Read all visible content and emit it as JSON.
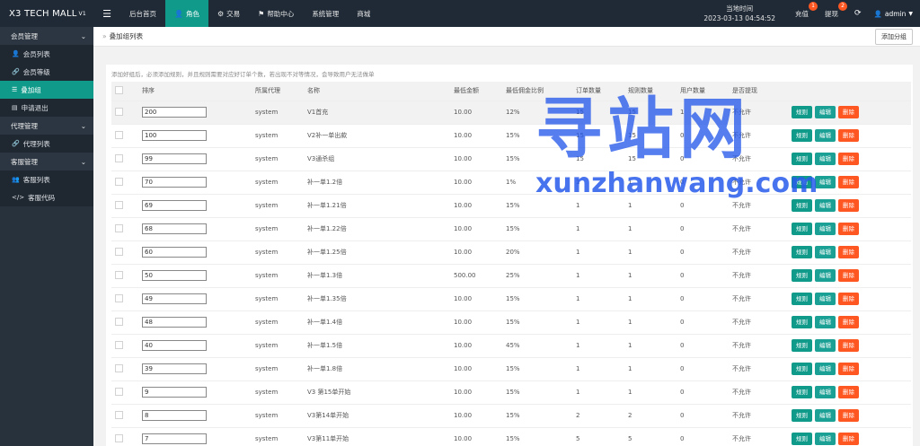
{
  "app": {
    "title": "X3 TECH MALL",
    "version": "V1"
  },
  "topnav": [
    {
      "label": "后台首页",
      "icon": "",
      "active": false
    },
    {
      "label": "角色",
      "icon": "user-icon",
      "active": true
    },
    {
      "label": "交易",
      "icon": "transaction-icon",
      "active": false
    },
    {
      "label": "帮助中心",
      "icon": "flag-icon",
      "active": false
    },
    {
      "label": "系统管理",
      "icon": "",
      "active": false
    },
    {
      "label": "商城",
      "icon": "",
      "active": false
    }
  ],
  "clock": {
    "label": "当地时间",
    "value": "2023-03-13 04:54:52"
  },
  "recharge": {
    "label": "充值",
    "badge": "1"
  },
  "withdraw": {
    "label": "提现",
    "badge": "2"
  },
  "user": {
    "name": "admin"
  },
  "sidebar": {
    "groups": [
      {
        "label": "会员管理",
        "items": [
          {
            "label": "会员列表",
            "icon": "user-icon",
            "active": false
          },
          {
            "label": "会员等级",
            "icon": "link-icon",
            "active": false
          },
          {
            "label": "叠加组",
            "icon": "list-icon",
            "active": true
          },
          {
            "label": "申请退出",
            "icon": "form-icon",
            "active": false
          }
        ]
      },
      {
        "label": "代理管理",
        "items": [
          {
            "label": "代理列表",
            "icon": "link-icon",
            "active": false
          }
        ]
      },
      {
        "label": "客服管理",
        "items": [
          {
            "label": "客服列表",
            "icon": "users-icon",
            "active": false
          },
          {
            "label": "客服代码",
            "icon": "code-icon",
            "active": false
          }
        ]
      }
    ]
  },
  "breadcrumb": {
    "sep": "»",
    "label": "叠加组列表"
  },
  "add_button": "添加分组",
  "notice": "添加好组后，必须添加规则，并且规则需要对应好订单个数，若出现不对等情况，会导致用户无法做单",
  "table": {
    "headers": [
      "",
      "排序",
      "所属代理",
      "名称",
      "最低金额",
      "最低佣金比例",
      "订单数量",
      "规则数量",
      "用户数量",
      "是否提现",
      ""
    ],
    "rows": [
      {
        "sort": "200",
        "agent": "system",
        "name": "V1首充",
        "min_amount": "10.00",
        "rate": "12%",
        "orders": "15",
        "rules": "15",
        "users": "1",
        "withdraw": "不允许",
        "highlight": true
      },
      {
        "sort": "100",
        "agent": "system",
        "name": "V2补一单出款",
        "min_amount": "10.00",
        "rate": "15%",
        "orders": "15",
        "rules": "15",
        "users": "0",
        "withdraw": "不允许",
        "highlight": false
      },
      {
        "sort": "99",
        "agent": "system",
        "name": "V3通杀组",
        "min_amount": "10.00",
        "rate": "15%",
        "orders": "15",
        "rules": "15",
        "users": "0",
        "withdraw": "不允许",
        "highlight": false
      },
      {
        "sort": "70",
        "agent": "system",
        "name": "补一单1.2倍",
        "min_amount": "10.00",
        "rate": "1%",
        "orders": "1",
        "rules": "1",
        "users": "0",
        "withdraw": "不允许",
        "highlight": false
      },
      {
        "sort": "69",
        "agent": "system",
        "name": "补一单1.21倍",
        "min_amount": "10.00",
        "rate": "15%",
        "orders": "1",
        "rules": "1",
        "users": "0",
        "withdraw": "不允许",
        "highlight": false
      },
      {
        "sort": "68",
        "agent": "system",
        "name": "补一单1.22倍",
        "min_amount": "10.00",
        "rate": "15%",
        "orders": "1",
        "rules": "1",
        "users": "0",
        "withdraw": "不允许",
        "highlight": false
      },
      {
        "sort": "60",
        "agent": "system",
        "name": "补一单1.25倍",
        "min_amount": "10.00",
        "rate": "20%",
        "orders": "1",
        "rules": "1",
        "users": "0",
        "withdraw": "不允许",
        "highlight": false
      },
      {
        "sort": "50",
        "agent": "system",
        "name": "补一单1.3倍",
        "min_amount": "500.00",
        "rate": "25%",
        "orders": "1",
        "rules": "1",
        "users": "0",
        "withdraw": "不允许",
        "highlight": false
      },
      {
        "sort": "49",
        "agent": "system",
        "name": "补一单1.35倍",
        "min_amount": "10.00",
        "rate": "15%",
        "orders": "1",
        "rules": "1",
        "users": "0",
        "withdraw": "不允许",
        "highlight": false
      },
      {
        "sort": "48",
        "agent": "system",
        "name": "补一单1.4倍",
        "min_amount": "10.00",
        "rate": "15%",
        "orders": "1",
        "rules": "1",
        "users": "0",
        "withdraw": "不允许",
        "highlight": false
      },
      {
        "sort": "40",
        "agent": "system",
        "name": "补一单1.5倍",
        "min_amount": "10.00",
        "rate": "45%",
        "orders": "1",
        "rules": "1",
        "users": "0",
        "withdraw": "不允许",
        "highlight": false
      },
      {
        "sort": "39",
        "agent": "system",
        "name": "补一单1.8倍",
        "min_amount": "10.00",
        "rate": "15%",
        "orders": "1",
        "rules": "1",
        "users": "0",
        "withdraw": "不允许",
        "highlight": false
      },
      {
        "sort": "9",
        "agent": "system",
        "name": "V3 第15单开始",
        "min_amount": "10.00",
        "rate": "15%",
        "orders": "1",
        "rules": "1",
        "users": "0",
        "withdraw": "不允许",
        "highlight": false
      },
      {
        "sort": "8",
        "agent": "system",
        "name": "V3第14单开始",
        "min_amount": "10.00",
        "rate": "15%",
        "orders": "2",
        "rules": "2",
        "users": "0",
        "withdraw": "不允许",
        "highlight": false
      },
      {
        "sort": "7",
        "agent": "system",
        "name": "V3第11单开始",
        "min_amount": "10.00",
        "rate": "15%",
        "orders": "5",
        "rules": "5",
        "users": "0",
        "withdraw": "不允许",
        "highlight": false
      }
    ],
    "actions": {
      "rule": "规则",
      "edit": "编辑",
      "delete": "删除"
    }
  },
  "watermark": {
    "big": "寻站网",
    "small": "xunzhanwang.com"
  },
  "colors": {
    "accent": "#0f9a8a",
    "danger": "#ff5722",
    "topbar": "#1f2a36",
    "sidebar": "#28323d"
  }
}
